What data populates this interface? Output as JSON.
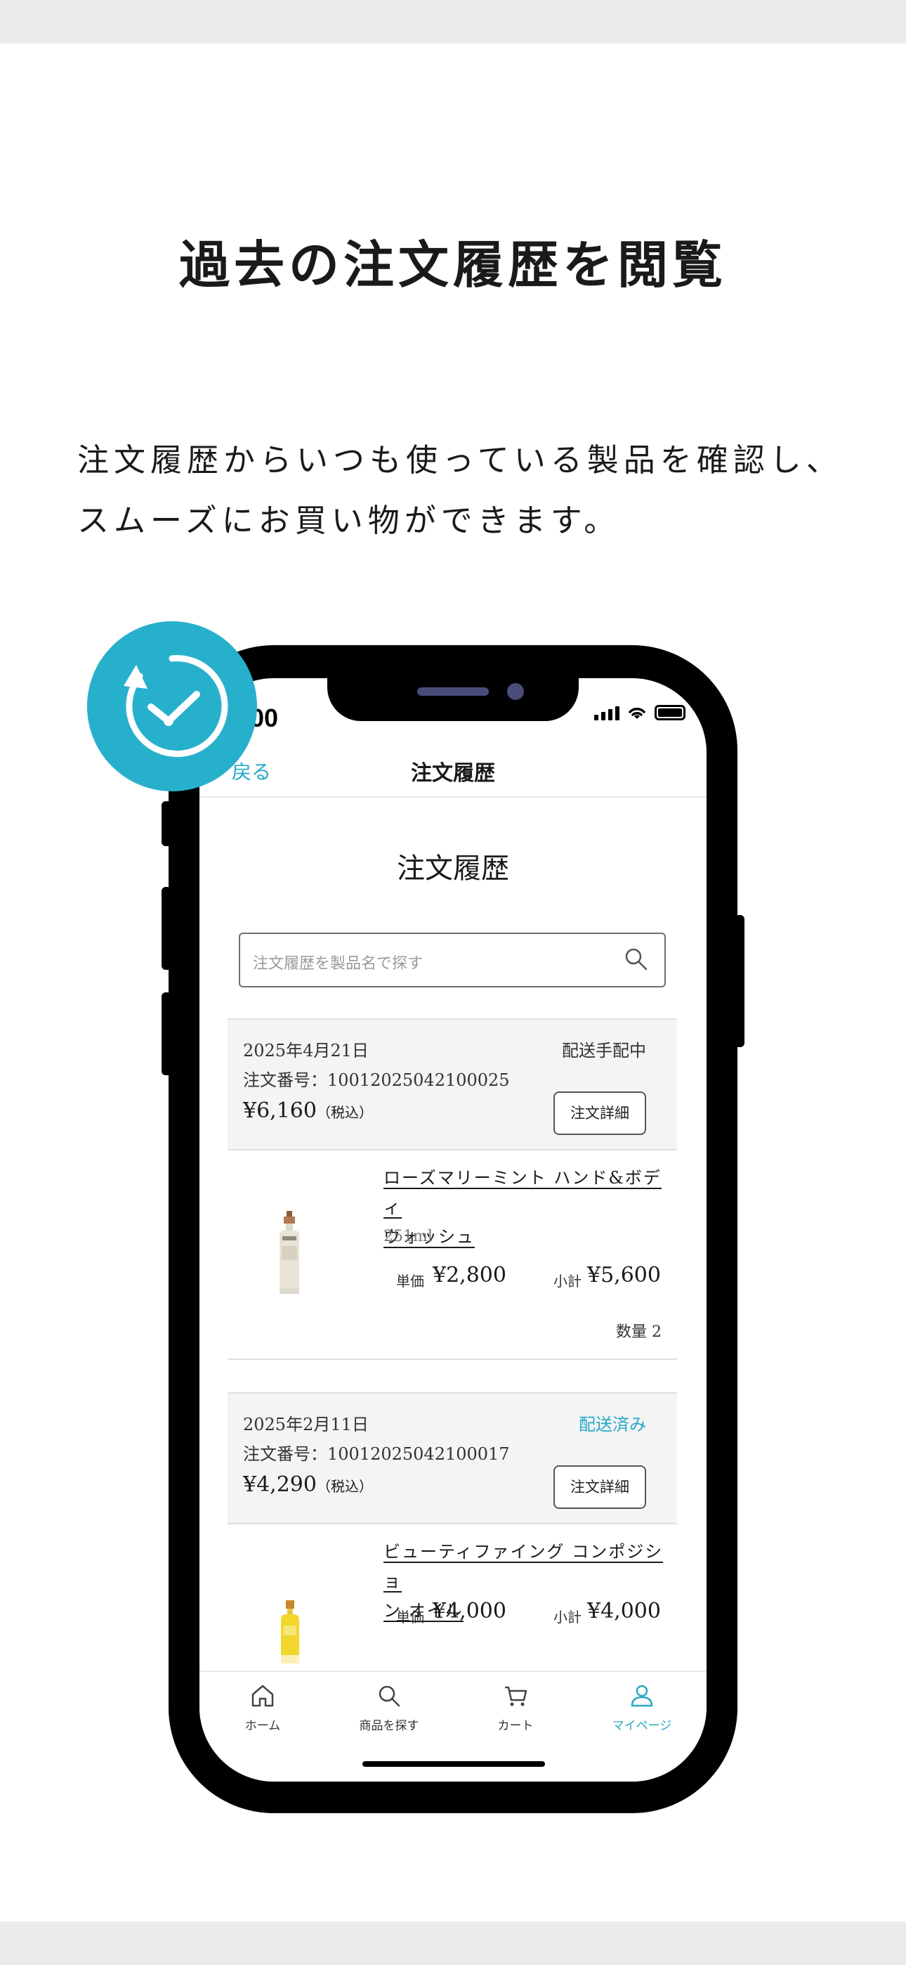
{
  "page": {
    "headline": "過去の注文履歴を閲覧",
    "description_line1": "注文履歴からいつも使っている製品を確認し、",
    "description_line2": "スムーズにお買い物ができます。"
  },
  "status_bar": {
    "time": ":00"
  },
  "nav": {
    "back_label": "戻る",
    "title": "注文履歴"
  },
  "main": {
    "page_title": "注文履歴",
    "search_placeholder": "注文履歴を製品名で探す"
  },
  "orders": [
    {
      "date": "2025年4月21日",
      "order_number": "注文番号：10012025042100025",
      "total": "¥6,160",
      "tax_label": "（税込）",
      "status": "配送手配中",
      "detail_button": "注文詳細",
      "item": {
        "name_line1": "ローズマリーミント ハンド&ボディ",
        "name_line2": "ウォッシュ",
        "volume": "251ml",
        "unit_label": "単価",
        "unit_price": "¥2,800",
        "subtotal_label": "小計",
        "subtotal": "¥5,600",
        "quantity": "数量 2"
      }
    },
    {
      "date": "2025年2月11日",
      "order_number": "注文番号：10012025042100017",
      "total": "¥4,290",
      "tax_label": "（税込）",
      "status": "配送済み",
      "detail_button": "注文詳細",
      "item": {
        "name_line1": "ビューティファイング コンポジショ",
        "name_line2": "ン オイル",
        "unit_label": "単価",
        "unit_price": "¥4,000",
        "subtotal_label": "小計",
        "subtotal": "¥4,000"
      }
    }
  ],
  "tabbar": {
    "items": [
      {
        "label": "ホーム",
        "icon": "home-icon"
      },
      {
        "label": "商品を探す",
        "icon": "search-icon"
      },
      {
        "label": "カート",
        "icon": "cart-icon"
      },
      {
        "label": "マイページ",
        "icon": "user-icon",
        "active": true
      }
    ]
  },
  "colors": {
    "accent": "#27a8c6",
    "badge": "#27b0cc",
    "band": "#ebebeb"
  }
}
